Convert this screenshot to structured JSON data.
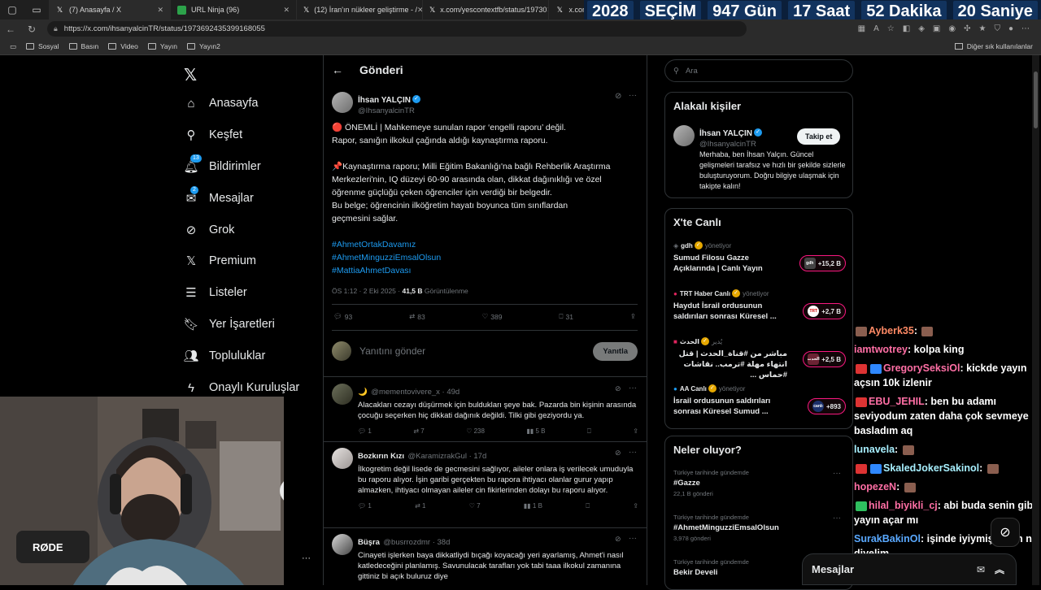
{
  "browser": {
    "tabs": [
      {
        "label": "(7) Anasayfa / X",
        "icon": "x-icon"
      },
      {
        "label": "URL Ninja (96)",
        "icon": "urlninja-icon"
      },
      {
        "label": "(12) İran'ın nükleer geliştirme - /",
        "icon": "x-icon"
      },
      {
        "label": "x.com/yescontextfb/status/19730",
        "icon": "x-icon"
      },
      {
        "label": "x.com/",
        "icon": "x-icon"
      }
    ],
    "url": "https://x.com/ihsanyalcinTR/status/1973692435399168055",
    "bookmarks": [
      "Sosyal",
      "Basın",
      "Video",
      "Yayın",
      "Yayın2"
    ],
    "other_bookmarks": "Diğer sık kullanılanlar"
  },
  "countdown": {
    "year": "2028",
    "label": "SEÇİM",
    "days": "947 Gün",
    "hours": "17 Saat",
    "minutes": "52 Dakika",
    "seconds": "20 Saniye"
  },
  "nav": {
    "items": [
      {
        "label": "Anasayfa",
        "icon": "home-icon"
      },
      {
        "label": "Keşfet",
        "icon": "search-icon"
      },
      {
        "label": "Bildirimler",
        "icon": "bell-icon",
        "badge": "13"
      },
      {
        "label": "Mesajlar",
        "icon": "mail-icon",
        "badge": "2"
      },
      {
        "label": "Grok",
        "icon": "grok-icon"
      },
      {
        "label": "Premium",
        "icon": "x-icon"
      },
      {
        "label": "Listeler",
        "icon": "list-icon"
      },
      {
        "label": "Yer İşaretleri",
        "icon": "bookmark-icon"
      },
      {
        "label": "Topluluklar",
        "icon": "people-icon"
      },
      {
        "label": "Onaylı Kuruluşlar",
        "icon": "lightning-icon"
      }
    ]
  },
  "post_header": {
    "title": "Gönderi"
  },
  "post": {
    "name": "İhsan YALÇIN",
    "handle": "@IhsanyalcinTR",
    "lines": [
      "🔴 ÖNEMLİ | Mahkemeye sunulan rapor ‘engelli raporu’ değil.",
      "Rapor, sanığın ilkokul çağında aldığı kaynaştırma raporu.",
      "📌Kaynaştırma raporu; Milli Eğitim Bakanlığı'na bağlı Rehberlik Araştırma",
      "Merkezleri'nin, IQ düzeyi 60-90 arasında olan, dikkat dağınıklığı ve özel",
      "öğrenme güçlüğü çeken öğrenciler için verdiği bir belgedir.",
      "Bu belge; öğrencinin ilköğretim hayatı boyunca tüm sınıflardan",
      "geçmesini sağlar."
    ],
    "hashtags": [
      "#AhmetOrtakDavamız",
      "#AhmetMinguzziEmsalOlsun",
      "#MattiaAhmetDavası"
    ],
    "time": "ÖS 1:12 · 2 Eki 2025 ·",
    "views": "41,5 B",
    "views_label": "Görüntülenme",
    "replies": "93",
    "reposts": "83",
    "likes": "389",
    "bookmarks": "31"
  },
  "reply_box": {
    "placeholder": "Yanıtını gönder",
    "button": "Yanıtla"
  },
  "replies": [
    {
      "name": "🌙",
      "handle": "@mementovivere_x · 49d",
      "text": "Alacakları cezayı düşürmek için buldukları şeye bak. Pazarda bin kişinin arasında çocuğu seçerken hiç dikkati dağınık değildi. Tilki gibi geziyordu ya.",
      "replies": "1",
      "reposts": "7",
      "likes": "238",
      "views": "5 B"
    },
    {
      "name": "Bozkırın Kızı",
      "handle": "@KaramizrakGul · 17d",
      "text": "İlkogretim değil lisede de gecmesini sağlıyor, aileler onlara iş verilecek umuduyla bu raporu alıyor. İşin garibi gerçekten bu rapora ihtiyacı olanlar gurur yapıp almazken, ihtiyacı olmayan aileler cin fikirlerinden dolayı bu raporu alıyor.",
      "replies": "1",
      "reposts": "1",
      "likes": "7",
      "views": "1 B"
    },
    {
      "name": "Büşra",
      "handle": "@busrrozdmr · 38d",
      "text": "Cinayeti işlerken baya dikkatliydi bıçağı koyacağı yeri ayarlamış, Ahmet'i nasıl katledeceğini planlamış. Savunulacak tarafları yok tabi taaa ilkokul zamanına gittiniz bi açık buluruz diye"
    }
  ],
  "search": {
    "placeholder": "Ara"
  },
  "related": {
    "title": "Alakalı kişiler",
    "name": "İhsan YALÇIN",
    "handle": "@IhsanyalcinTR",
    "follow": "Takip et",
    "bio": "Merhaba, ben İhsan Yalçın. Güncel gelişmeleri tarafsız ve hızlı bir şekilde sizlerle buluşturuyorum. Doğru bilgiye ulaşmak için takipte kalın!"
  },
  "live": {
    "title": "X'te Canlı",
    "items": [
      {
        "source": "gdh",
        "mod": "yönetiyor",
        "title": "Sumud Filosu Gazze Açıklarında | Canlı Yayın",
        "count": "+15,2 B",
        "thumb": "gdh"
      },
      {
        "source": "TRT Haber Canlı",
        "mod": "yönetiyor",
        "title": "Haydut İsrail ordusunun saldırıları sonrası Küresel ...",
        "count": "+2,7 B",
        "thumb": "TRT"
      },
      {
        "source": "الحدث",
        "mod": "يُدير",
        "title": "مباشر من #قناة_الحدث | قتل انتهاء مهلة #ترمب.. نقاشات #حماس ...",
        "count": "+2,5 B",
        "thumb": "الحدث"
      },
      {
        "source": "AA Canlı",
        "mod": "yönetiyor",
        "title": "İsrail ordusunun saldırıları sonrası Küresel Sumud ...",
        "count": "+893",
        "thumb": "canlı"
      }
    ]
  },
  "trends": {
    "title": "Neler oluyor?",
    "items": [
      {
        "context": "Türkiye tarihinde gündemde",
        "name": "#Gazze",
        "count": "22,1 B gönderi"
      },
      {
        "context": "Türkiye tarihinde gündemde",
        "name": "#AhmetMinguzziEmsalOlsun",
        "count": "3,978 gönderi"
      },
      {
        "context": "Türkiye tarihinde gündemde",
        "name": "Bekir Develi",
        "count": ""
      }
    ]
  },
  "messages_bar": {
    "label": "Mesajlar"
  },
  "chat": [
    {
      "user": "Ayberk35",
      "msg": "",
      "color": "#ff8a65"
    },
    {
      "user": "iamtwotrey",
      "msg": "kolpa king",
      "color": "#ff6fa5"
    },
    {
      "user": "GregorySeksiOl",
      "msg": "kickde yayın açsın 10k izlenir",
      "color": "#ff6fa5"
    },
    {
      "user": "EBU_JEHIL",
      "msg": "ben bu adamı seviyodum zaten daha çok sevmeye basladım aq",
      "color": "#ff6fa5"
    },
    {
      "user": "lunavela",
      "msg": "",
      "color": "#a8f0ff"
    },
    {
      "user": "SkaledJokerSakinol",
      "msg": "",
      "color": "#a8f0ff"
    },
    {
      "user": "hopezeN",
      "msg": "",
      "color": "#ff6fa5"
    },
    {
      "user": "hilal_biyikli_cj",
      "msg": "abi buda senin gibi yayın açar mı",
      "color": "#ff6fa5"
    },
    {
      "user": "SurakBakinOl",
      "msg": "işinde iyiymiş adam ne diyelim",
      "color": "#5aa9ff"
    }
  ],
  "colors": {
    "accent": "#1d9bf0",
    "live_border": "#f91880",
    "bg": "#000000",
    "text": "#e7e9ea",
    "muted": "#71767b"
  }
}
